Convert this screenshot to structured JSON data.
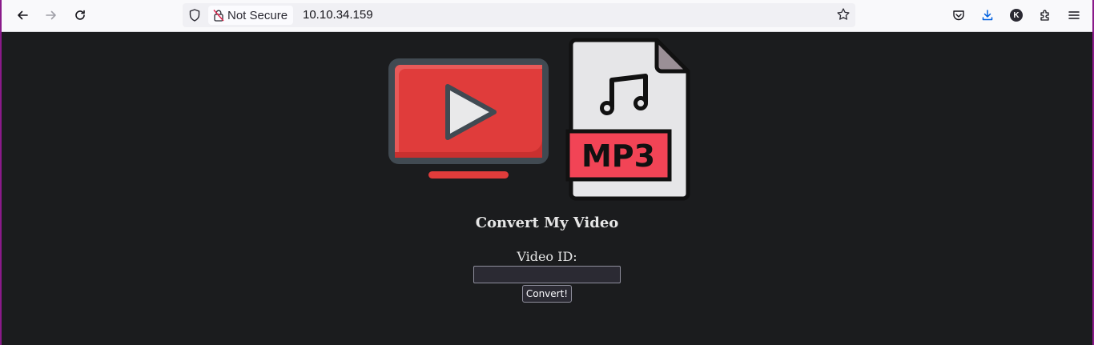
{
  "browser": {
    "security_label": "Not Secure",
    "url": "10.10.34.159",
    "account_initial": "K"
  },
  "logo": {
    "badge_text": "MP3",
    "icons": [
      "tv-play-icon",
      "mp3-file-icon"
    ]
  },
  "page": {
    "title": "Convert My Video",
    "field_label": "Video ID:",
    "input_value": "",
    "input_placeholder": "",
    "submit_label": "Convert!"
  },
  "colors": {
    "page_background": "#1b1c1e",
    "tv_red": "#e03c3b",
    "tv_frame": "#414a52",
    "mp3_badge": "#f24456"
  }
}
